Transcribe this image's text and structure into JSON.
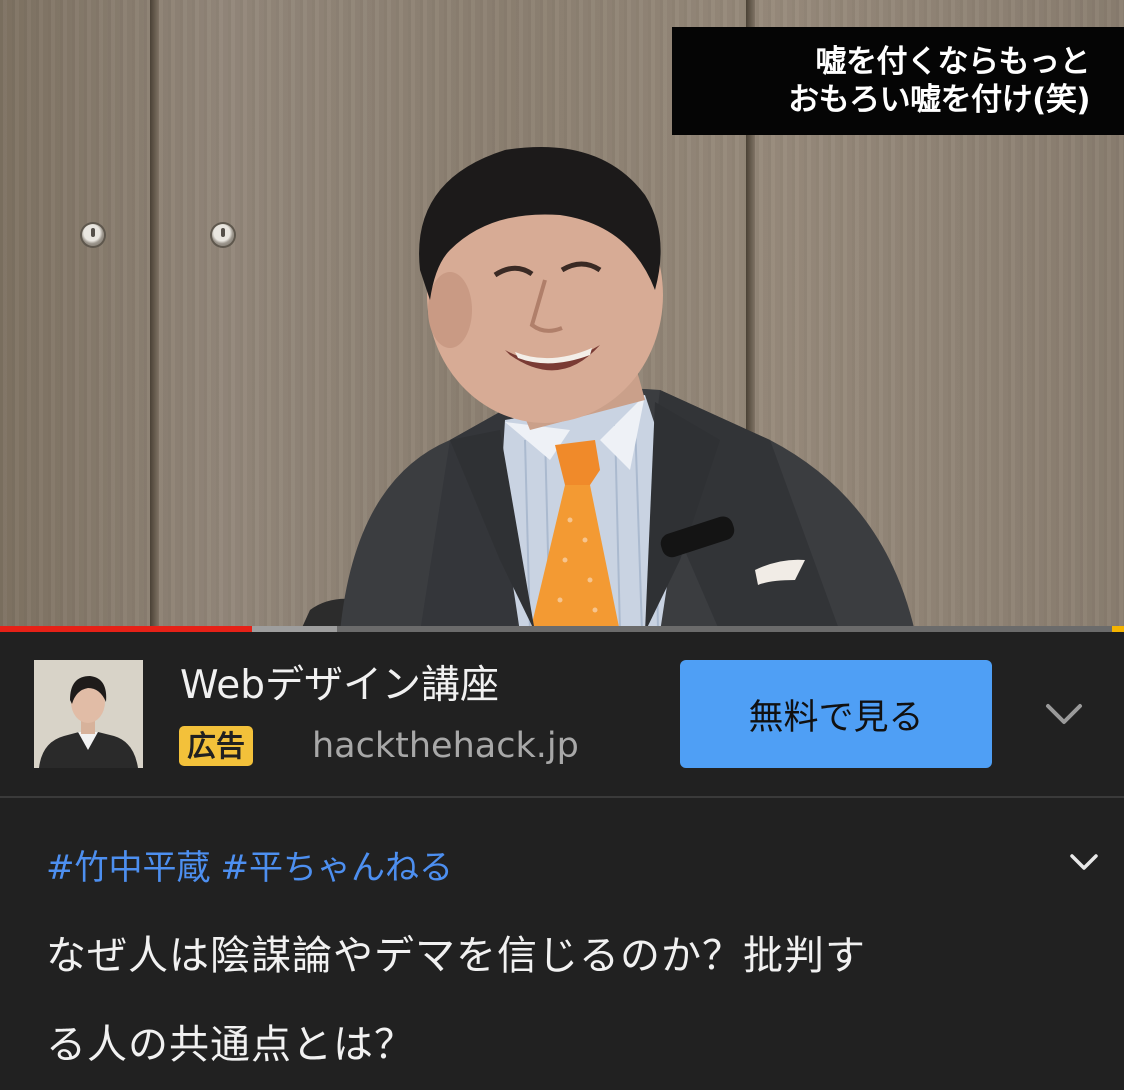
{
  "video": {
    "caption_lines": [
      "嘘を付くならもっと",
      "おもろい嘘を付け(笑)"
    ],
    "progress": {
      "played_fraction": 0.224,
      "buffered_fraction": 0.3
    }
  },
  "ad": {
    "title": "Webデザイン講座",
    "badge": "広告",
    "domain": "hackthehack.jp",
    "cta_label": "無料で見る",
    "badge_color": "#f3c13a",
    "cta_color": "#4f9ff5"
  },
  "description": {
    "hashtags": [
      "#竹中平蔵",
      "#平ちゃんねる"
    ],
    "title_lines": [
      "なぜ人は陰謀論やデマを信じるのか？批判す",
      "る人の共通点とは？"
    ]
  },
  "colors": {
    "background": "#212121",
    "progress_played": "#e62117",
    "hashtag": "#4d8ff0"
  },
  "icons": {
    "ad_expand": "chevron-down-icon",
    "description_expand": "chevron-down-icon"
  }
}
